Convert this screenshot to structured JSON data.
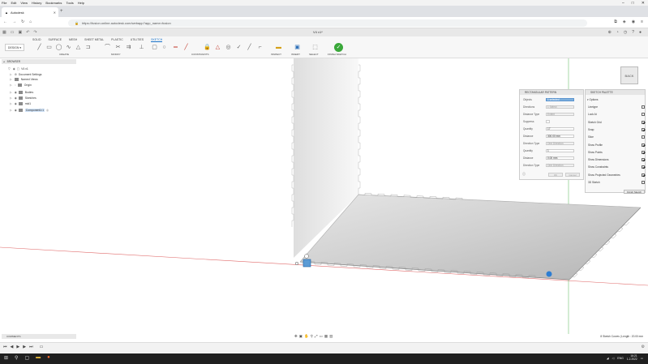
{
  "menubar": [
    "File",
    "Edit",
    "View",
    "History",
    "Bookmarks",
    "Tools",
    "Help"
  ],
  "browser": {
    "tab_title": "Autodesk",
    "url": "https://fusion.online.autodesk.com/webapp?app_name=fusion"
  },
  "app": {
    "doc_title": "V4 v1*",
    "workspace": "DESIGN",
    "tool_tabs": [
      "SOLID",
      "SURFACE",
      "MESH",
      "SHEET METAL",
      "PLASTIC",
      "UTILITIES",
      "SKETCH"
    ],
    "groups": [
      "CREATE",
      "MODIFY",
      "CONSTRAINTS",
      "INSPECT",
      "INSERT",
      "SELECT",
      "FINISH SKETCH"
    ]
  },
  "browser_panel": {
    "header": "BROWSER",
    "root": "V4 v1",
    "items": [
      "Document Settings",
      "Named Views",
      "Origin",
      "Bodies",
      "Sketches",
      "mid1",
      "Component1:1"
    ]
  },
  "viewcube_label": "BACK",
  "pattern": {
    "title": "RECTANGULAR PATTERN",
    "rows": [
      {
        "label": "Objects",
        "value": "1 selected"
      },
      {
        "label": "Directions",
        "value": "1 Select"
      },
      {
        "label": "Distance Type",
        "value": "Extent"
      },
      {
        "label": "Suppress",
        "value": ""
      },
      {
        "label": "Quantity",
        "value": "17"
      },
      {
        "label": "Distance",
        "value": "300.00 mm"
      },
      {
        "label": "Direction Type",
        "value": "One Direction"
      },
      {
        "label": "Quantity",
        "value": "1"
      },
      {
        "label": "Distance",
        "value": "0.00 mm"
      },
      {
        "label": "Direction Type",
        "value": "One Direction"
      }
    ],
    "ok": "OK",
    "cancel": "Cancel"
  },
  "palette": {
    "title": "SKETCH PALETTE",
    "options_label": "Options",
    "options": [
      {
        "label": "Linetype",
        "checked": false
      },
      {
        "label": "Look At",
        "checked": false
      },
      {
        "label": "Sketch Grid",
        "checked": true
      },
      {
        "label": "Snap",
        "checked": true
      },
      {
        "label": "Slice",
        "checked": false
      },
      {
        "label": "Show Profile",
        "checked": true
      },
      {
        "label": "Show Points",
        "checked": true
      },
      {
        "label": "Show Dimensions",
        "checked": true
      },
      {
        "label": "Show Constraints",
        "checked": true
      },
      {
        "label": "Show Projected Geometries",
        "checked": true
      },
      {
        "label": "3D Sketch",
        "checked": false
      }
    ],
    "finish": "Finish Sketch"
  },
  "bottom": {
    "comments": "COMMENTS",
    "status": "8 Sketch Curves | Length : 20.00 mm"
  },
  "taskbar": {
    "lang": "ENG",
    "time": "16:21",
    "date": "1.2.2022"
  }
}
